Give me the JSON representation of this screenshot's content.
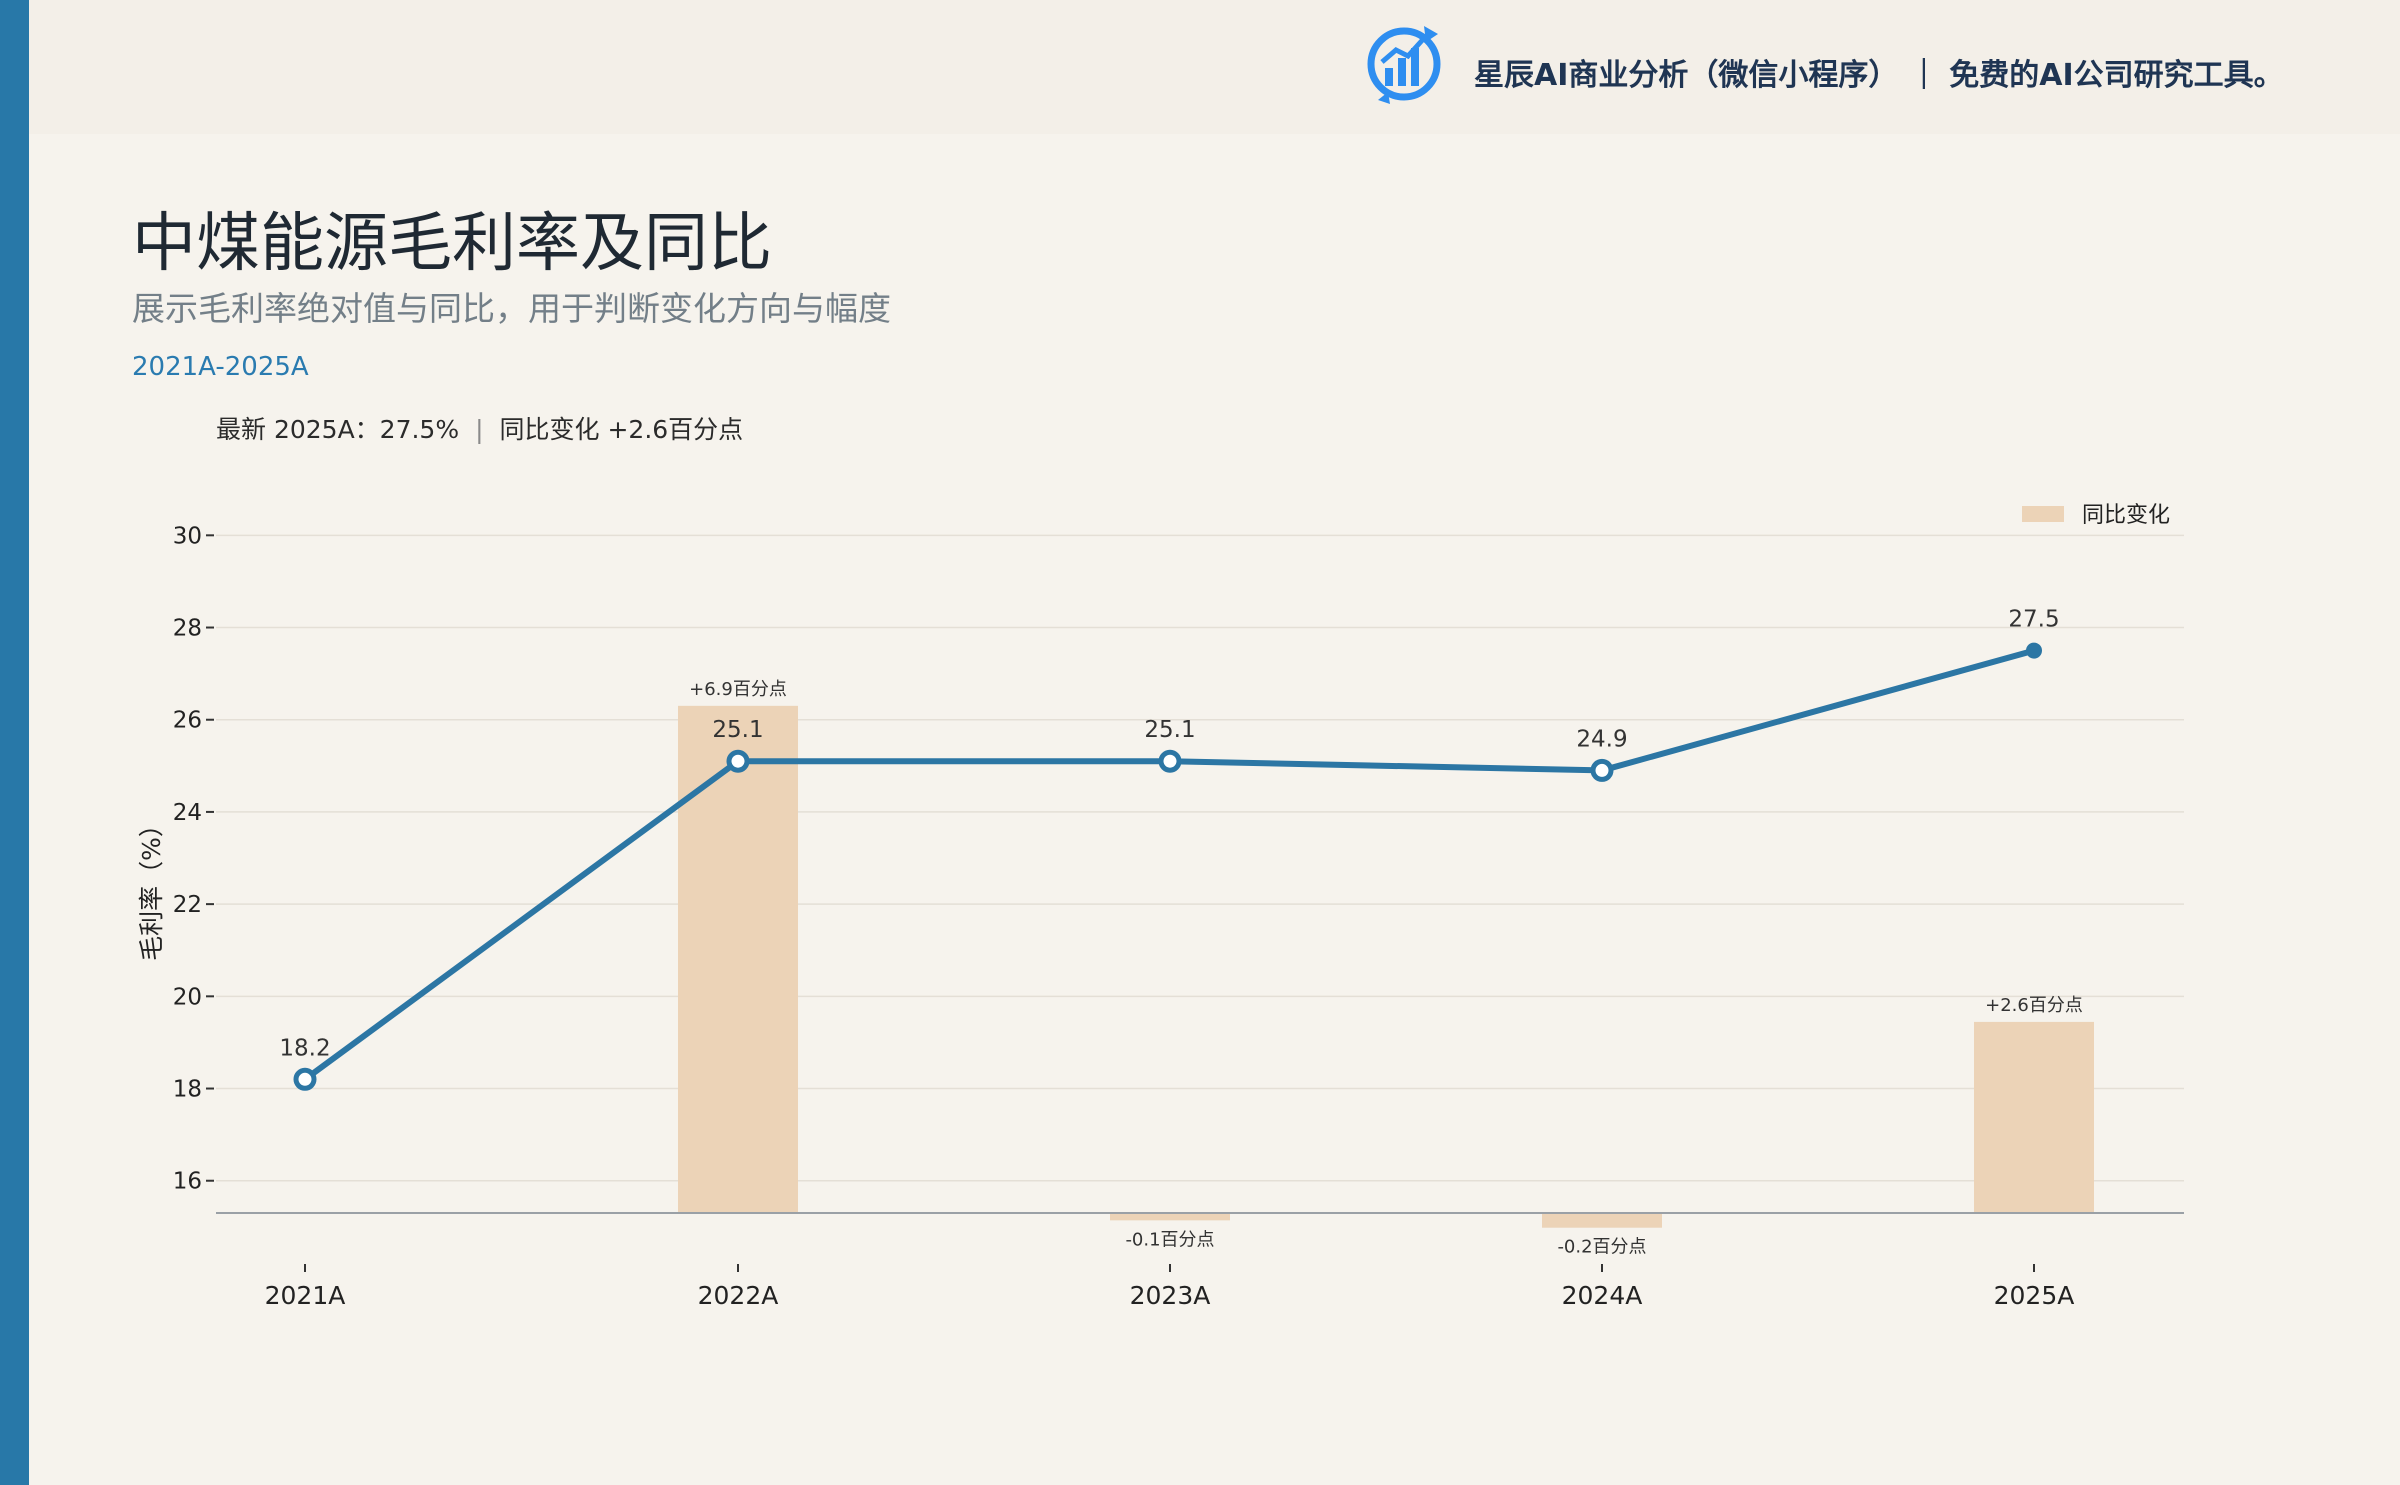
{
  "brand": {
    "text": "星辰AI商业分析（微信小程序） ｜ 免费的AI公司研究工具。",
    "logo_icon": "bar-chart-refresh-icon",
    "accent": "#2e8ef0"
  },
  "header": {
    "title": "中煤能源毛利率及同比",
    "subtitle": "展示毛利率绝对值与同比，用于判断变化方向与幅度",
    "period": "2021A-2025A",
    "summary_latest": "最新 2025A：27.5%",
    "summary_sep": "|",
    "summary_change": "同比变化 +2.6百分点"
  },
  "colors": {
    "line": "#2c76a4",
    "bar": "#ecd3b7",
    "left_bar": "#2878a8",
    "background": "#f6f3ed"
  },
  "chart_data": {
    "type": "bar+line",
    "categories": [
      "2021A",
      "2022A",
      "2023A",
      "2024A",
      "2025A"
    ],
    "ylabel": "毛利率（%）",
    "ylim": [
      15.3,
      31.2
    ],
    "yticks": [
      16,
      18,
      20,
      22,
      24,
      26,
      28,
      30
    ],
    "grid": true,
    "legend_position": "top-right",
    "line_series": {
      "values": [
        18.2,
        25.1,
        25.1,
        24.9,
        27.5
      ],
      "labels": [
        "18.2",
        "25.1",
        "25.1",
        "24.9",
        "27.5"
      ]
    },
    "bar_series": {
      "name": "同比变化",
      "values": [
        null,
        6.9,
        -0.1,
        -0.2,
        2.6
      ],
      "labels": [
        "",
        "+6.9百分点",
        "-0.1百分点",
        "-0.2百分点",
        "+2.6百分点"
      ]
    }
  }
}
